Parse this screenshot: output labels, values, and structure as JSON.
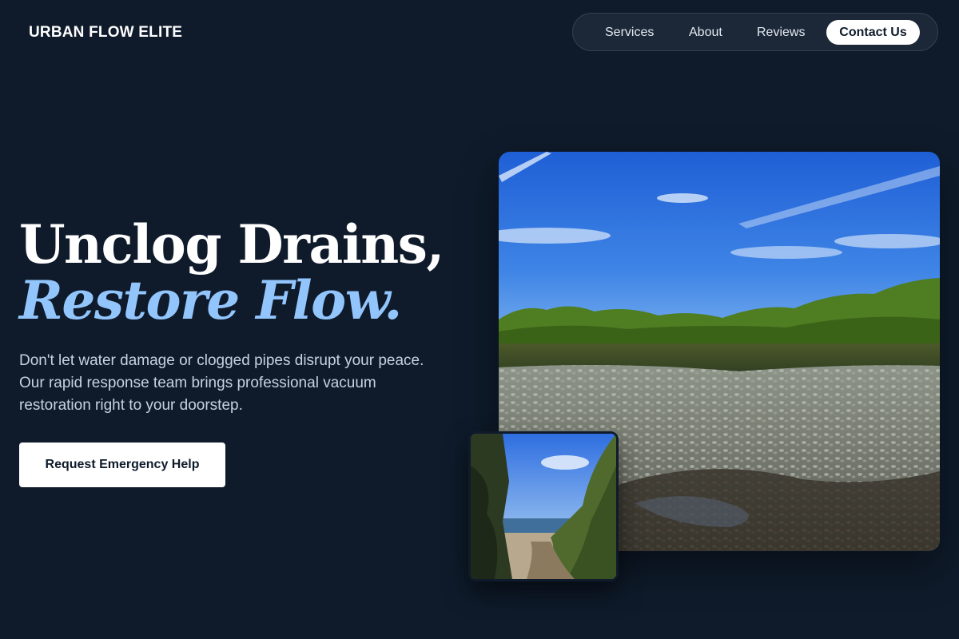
{
  "header": {
    "brand": "URBAN FLOW ELITE",
    "nav": {
      "services": "Services",
      "about": "About",
      "reviews": "Reviews",
      "contact": "Contact Us"
    }
  },
  "hero": {
    "title_line1": "Unclog Drains,",
    "title_line2": "Restore Flow.",
    "description": "Don't let water damage or clogged pipes disrupt your peace. Our rapid response team brings professional vacuum restoration right to your doorstep.",
    "cta_label": "Request Emergency Help"
  },
  "images": {
    "main": {
      "subject": "tidal-flat-landscape-photo"
    },
    "small": {
      "subject": "beach-path-photo"
    }
  },
  "colors": {
    "background": "#0f1b2b",
    "accent": "#93c5fd",
    "nav_pill": "#1c2838",
    "button": "#ffffff"
  }
}
